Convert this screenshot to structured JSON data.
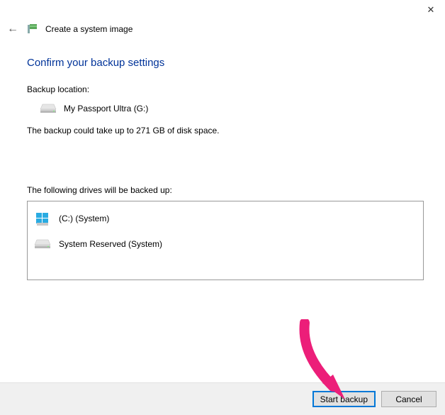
{
  "window": {
    "title": "Create a system image"
  },
  "main": {
    "heading": "Confirm your backup settings",
    "backup_location_label": "Backup location:",
    "backup_location_value": "My Passport Ultra (G:)",
    "size_note": "The backup could take up to 271 GB of disk space.",
    "drives_label": "The following drives will be backed up:",
    "drives": [
      {
        "label": "(C:) (System)"
      },
      {
        "label": "System Reserved (System)"
      }
    ]
  },
  "footer": {
    "start_label": "Start backup",
    "cancel_label": "Cancel"
  }
}
